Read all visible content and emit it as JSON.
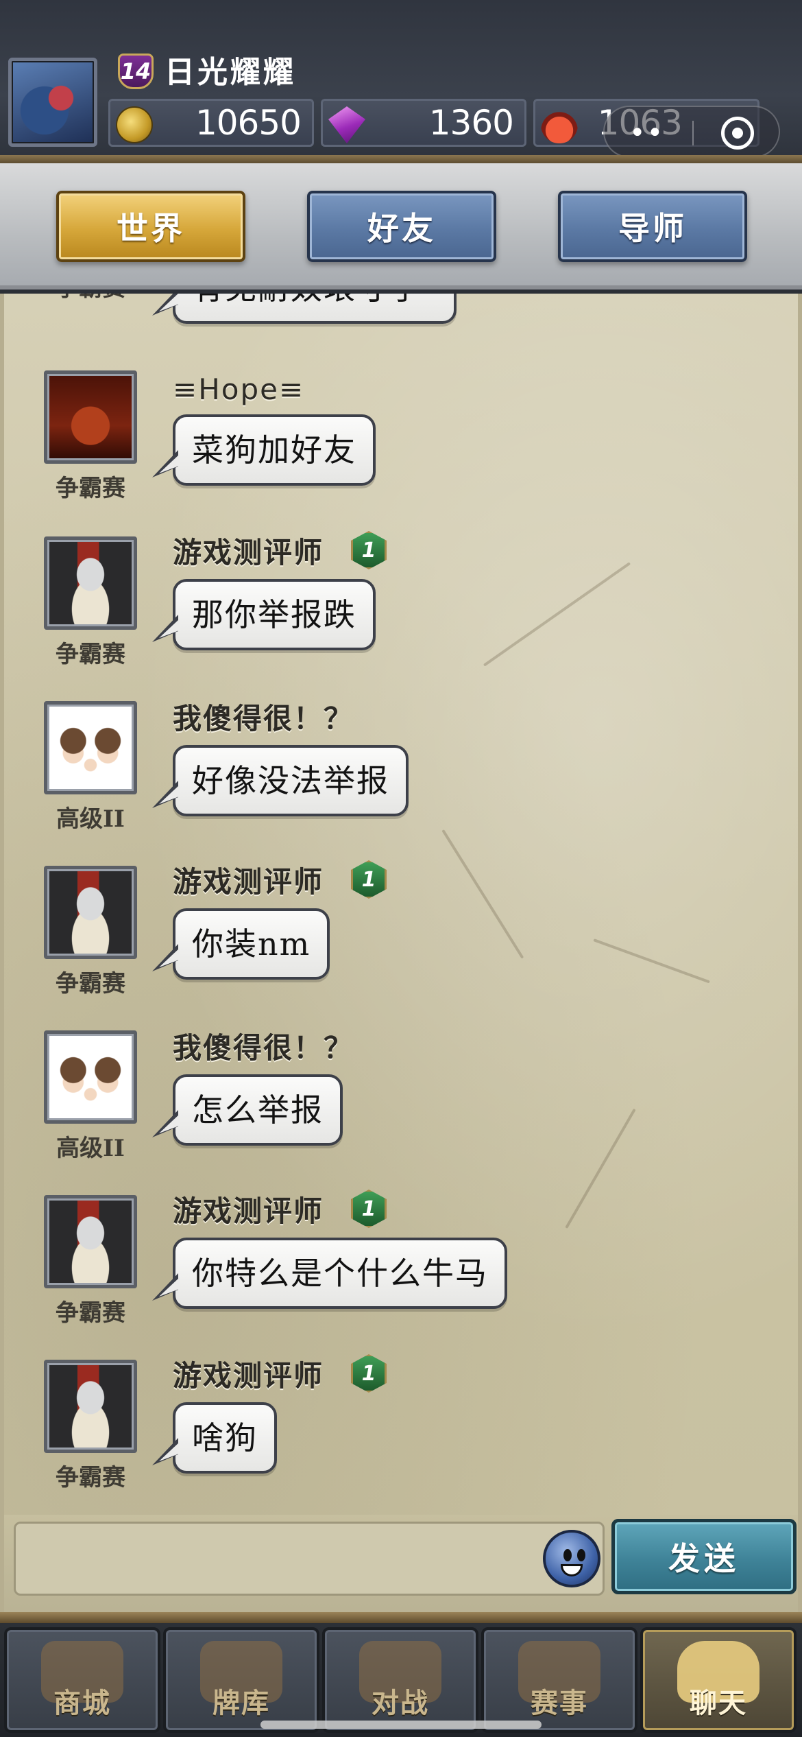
{
  "player": {
    "level": "14",
    "name": "日光耀耀",
    "gold": "10650",
    "gems": "1360",
    "potion": "1063"
  },
  "capsule": {
    "dots": "••"
  },
  "tabs": [
    {
      "label": "世界",
      "active": true
    },
    {
      "label": "好友",
      "active": false
    },
    {
      "label": "导师",
      "active": false
    }
  ],
  "chat": {
    "partial_message": {
      "rank": "争霸赛",
      "text": "有免耐奴琅寸了"
    },
    "messages": [
      {
        "name": "≡Hope≡",
        "rank": "争霸赛",
        "text": "菜狗加好友",
        "badge": false,
        "avatar": "demon-avatar"
      },
      {
        "name": "游戏测评师",
        "rank": "争霸赛",
        "text": "那你举报跌",
        "badge": true,
        "avatar": "knight-avatar"
      },
      {
        "name": "我傻得很！？",
        "rank": "高级II",
        "text": "好像没法举报",
        "badge": false,
        "avatar": "family-avatar"
      },
      {
        "name": "游戏测评师",
        "rank": "争霸赛",
        "text": "你装nm",
        "badge": true,
        "avatar": "knight-avatar"
      },
      {
        "name": "我傻得很！？",
        "rank": "高级II",
        "text": "怎么举报",
        "badge": false,
        "avatar": "family-avatar"
      },
      {
        "name": "游戏测评师",
        "rank": "争霸赛",
        "text": "你特么是个什么牛马",
        "badge": true,
        "avatar": "knight-avatar"
      },
      {
        "name": "游戏测评师",
        "rank": "争霸赛",
        "text": "啥狗",
        "badge": true,
        "avatar": "knight-avatar"
      }
    ]
  },
  "input": {
    "value": "",
    "placeholder": "",
    "send_label": "发送"
  },
  "nav": [
    {
      "label": "商城",
      "icon": "shop-icon",
      "active": false
    },
    {
      "label": "牌库",
      "icon": "cards-icon",
      "active": false
    },
    {
      "label": "对战",
      "icon": "swords-icon",
      "active": false
    },
    {
      "label": "赛事",
      "icon": "trophy-icon",
      "active": false
    },
    {
      "label": "聊天",
      "icon": "handshake-icon",
      "active": true
    }
  ],
  "colors": {
    "tab_active": "#d6a73a",
    "tab_inactive": "#5b79a4",
    "send_button": "#3f8398",
    "parchment": "#cbc4a5"
  }
}
